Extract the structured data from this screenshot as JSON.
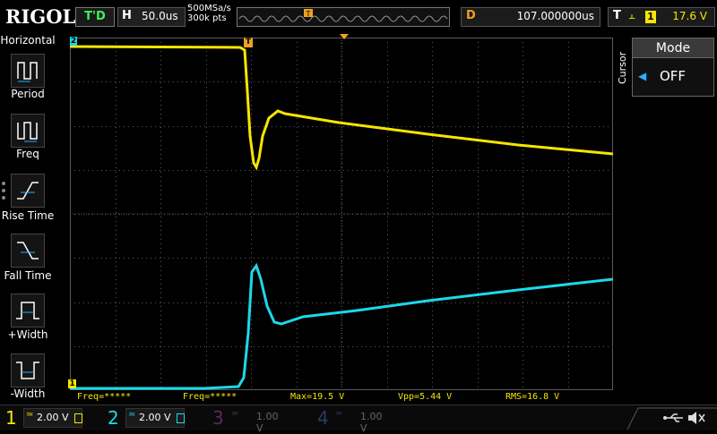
{
  "brand": "RIGOL",
  "top": {
    "trigger_status": "T'D",
    "horizontal": {
      "key": "H",
      "value": "50.0us"
    },
    "sample_rate": "500MSa/s",
    "memory_depth": "300k pts",
    "delay": {
      "key": "D",
      "value": "107.000000us"
    },
    "trigger": {
      "key": "T",
      "edge": "⫠",
      "channel": "1",
      "level": "17.6 V"
    }
  },
  "left_menu": {
    "title": "Horizontal",
    "items": [
      {
        "label": "Period"
      },
      {
        "label": "Freq"
      },
      {
        "label": "Rise Time"
      },
      {
        "label": "Fall Time"
      },
      {
        "label": "+Width"
      },
      {
        "label": "-Width"
      }
    ]
  },
  "markers": {
    "trigger_pos": "T",
    "trigger_level": "T",
    "ch1": "1",
    "ch2": "2"
  },
  "measurements": [
    {
      "text": "Freq=*****"
    },
    {
      "text": "Freq=*****"
    },
    {
      "text": "Max=19.5 V"
    },
    {
      "text": "Vpp=5.44 V"
    },
    {
      "text": "RMS=16.8 V"
    }
  ],
  "right_panel": {
    "title": "Mode",
    "value": "OFF",
    "side_label": "Cursor"
  },
  "channels": [
    {
      "number": "1",
      "scale": "2.00 V",
      "coupling": "≃",
      "color": "#f5e600",
      "active": true
    },
    {
      "number": "2",
      "scale": "2.00 V",
      "coupling": "≃",
      "color": "#1ed8e8",
      "active": true
    },
    {
      "number": "3",
      "scale": "1.00 V",
      "coupling": "≃",
      "color": "#b01ab0",
      "active": false
    },
    {
      "number": "4",
      "scale": "1.00 V",
      "coupling": "≃",
      "color": "#2a6be0",
      "active": false
    }
  ],
  "colors": {
    "ch1": "#f5e600",
    "ch2": "#1ed8e8",
    "accent": "#f0a020",
    "grid": "#5a5a5a"
  }
}
